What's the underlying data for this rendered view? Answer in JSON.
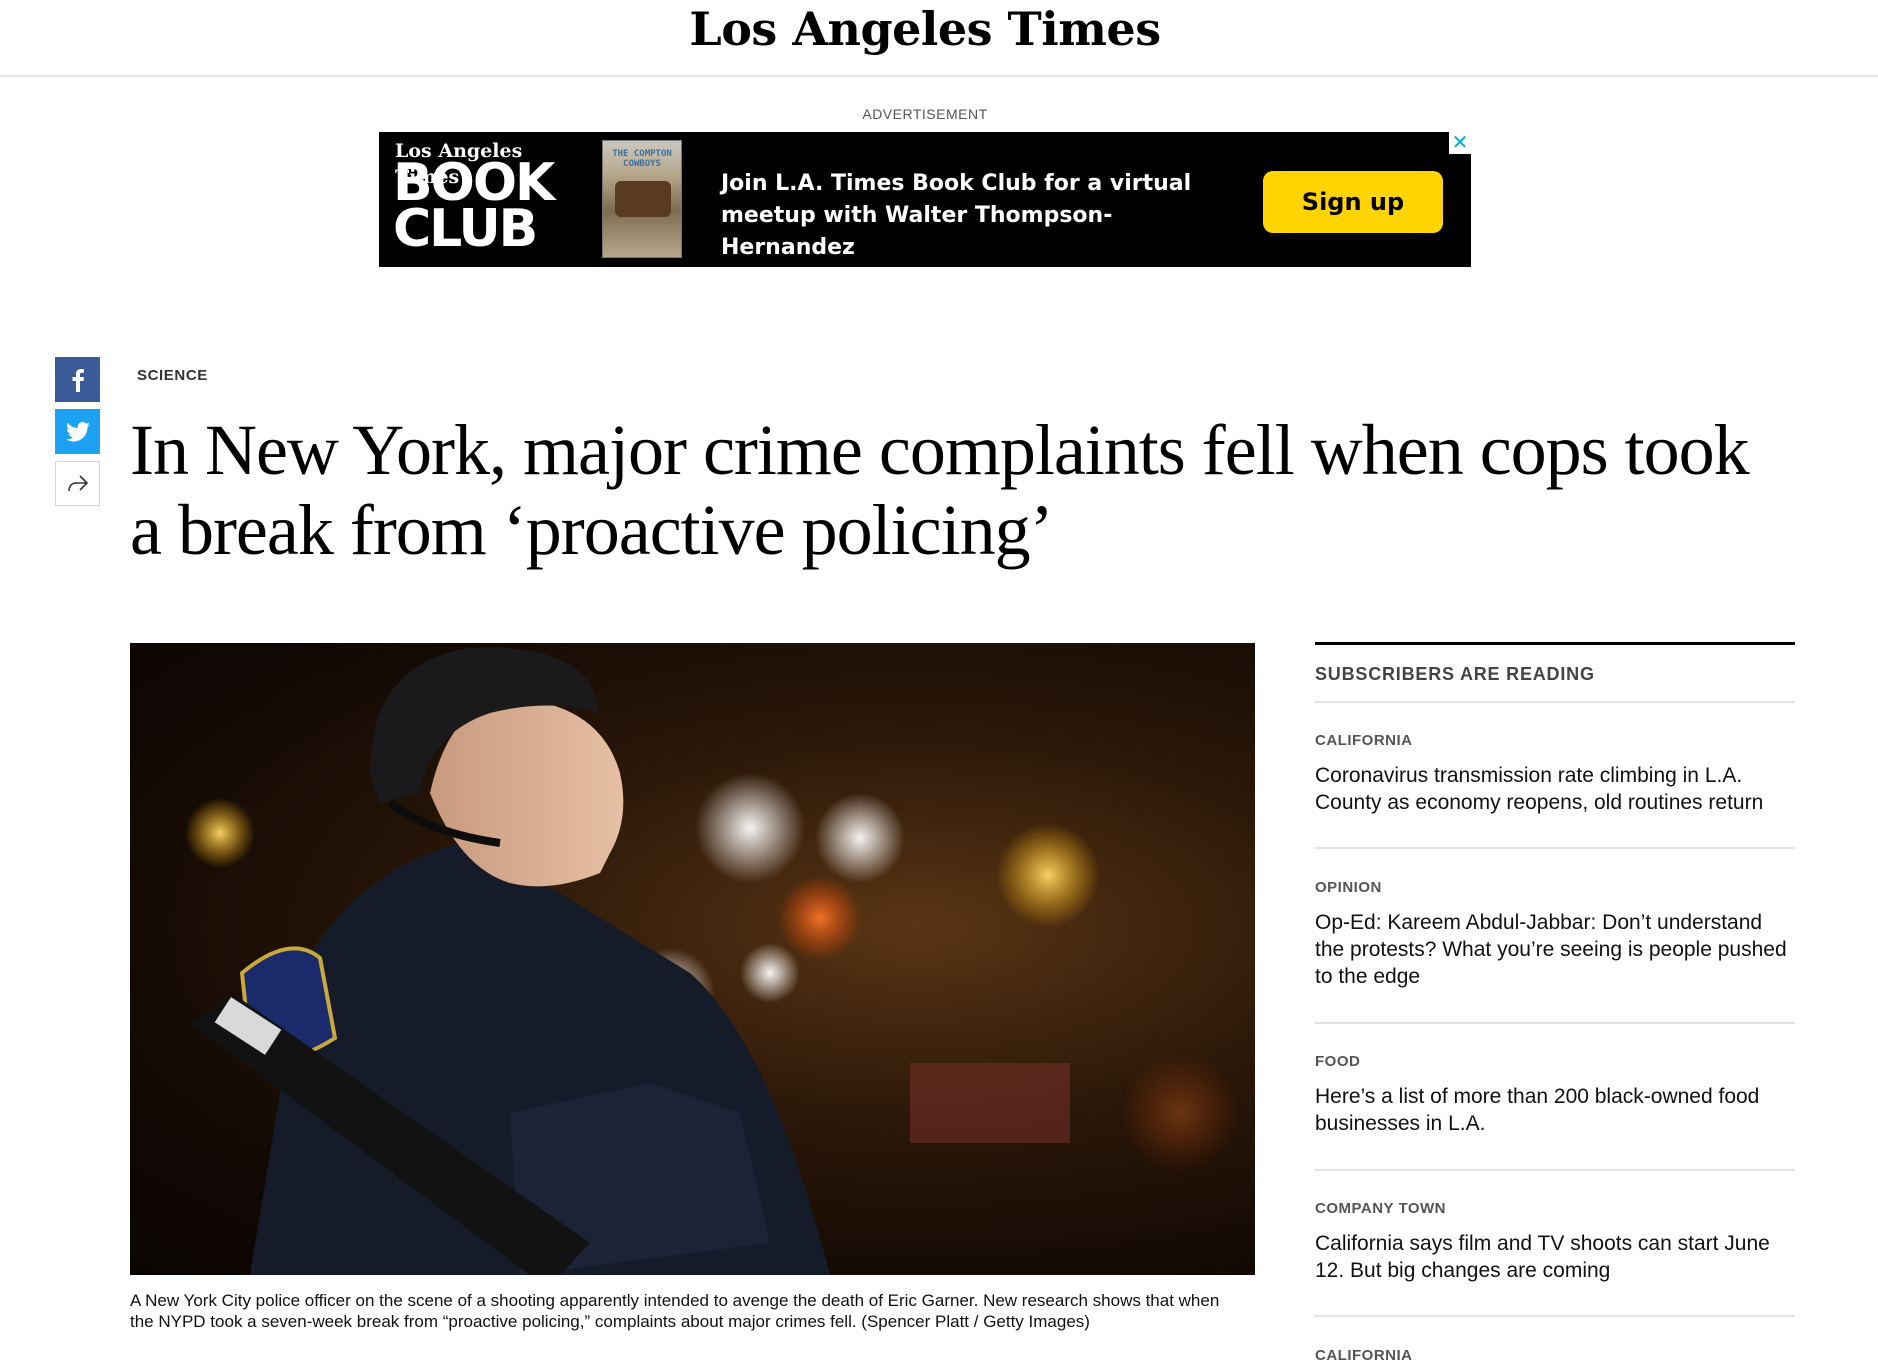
{
  "masthead": {
    "logo": "Los Angeles Times"
  },
  "ad": {
    "label": "ADVERTISEMENT",
    "close": "✕",
    "brand_small": "Los Angeles Times",
    "brand_big_1": "BOOK",
    "brand_big_2": "CLUB",
    "book_title": "THE COMPTON COWBOYS",
    "text": "Join L.A. Times Book Club for a virtual meetup with Walter Thompson-Hernandez",
    "cta": "Sign up"
  },
  "share": {
    "facebook_icon": "facebook-icon",
    "twitter_icon": "twitter-icon",
    "more_icon": "share-arrow-icon"
  },
  "article": {
    "section": "SCIENCE",
    "headline": "In New York, major crime complaints fell when cops took a break from ‘proactive policing’",
    "caption": "A New York City police officer on the scene of a shooting apparently intended to avenge the death of Eric Garner. New research shows that when the NYPD took a seven-week break from “proactive policing,” complaints about major crimes fell. (Spencer Platt / Getty Images)"
  },
  "sidebar": {
    "title": "SUBSCRIBERS ARE READING",
    "stories": [
      {
        "kicker": "CALIFORNIA",
        "headline": "Coronavirus transmission rate climbing in L.A. County as economy reopens, old routines return"
      },
      {
        "kicker": "OPINION",
        "headline": "Op-Ed: Kareem Abdul-Jabbar: Don’t understand the protests? What you’re seeing is people pushed to the edge"
      },
      {
        "kicker": "FOOD",
        "headline": "Here’s a list of more than 200 black-owned food businesses in L.A."
      },
      {
        "kicker": "COMPANY TOWN",
        "headline": "California says film and TV shoots can start June 12. But big changes are coming"
      },
      {
        "kicker": "CALIFORNIA",
        "headline": ""
      }
    ]
  },
  "colors": {
    "facebook": "#3b5b98",
    "twitter": "#1da1f2",
    "cta_yellow": "#ffd400",
    "ad_bg": "#000000"
  }
}
